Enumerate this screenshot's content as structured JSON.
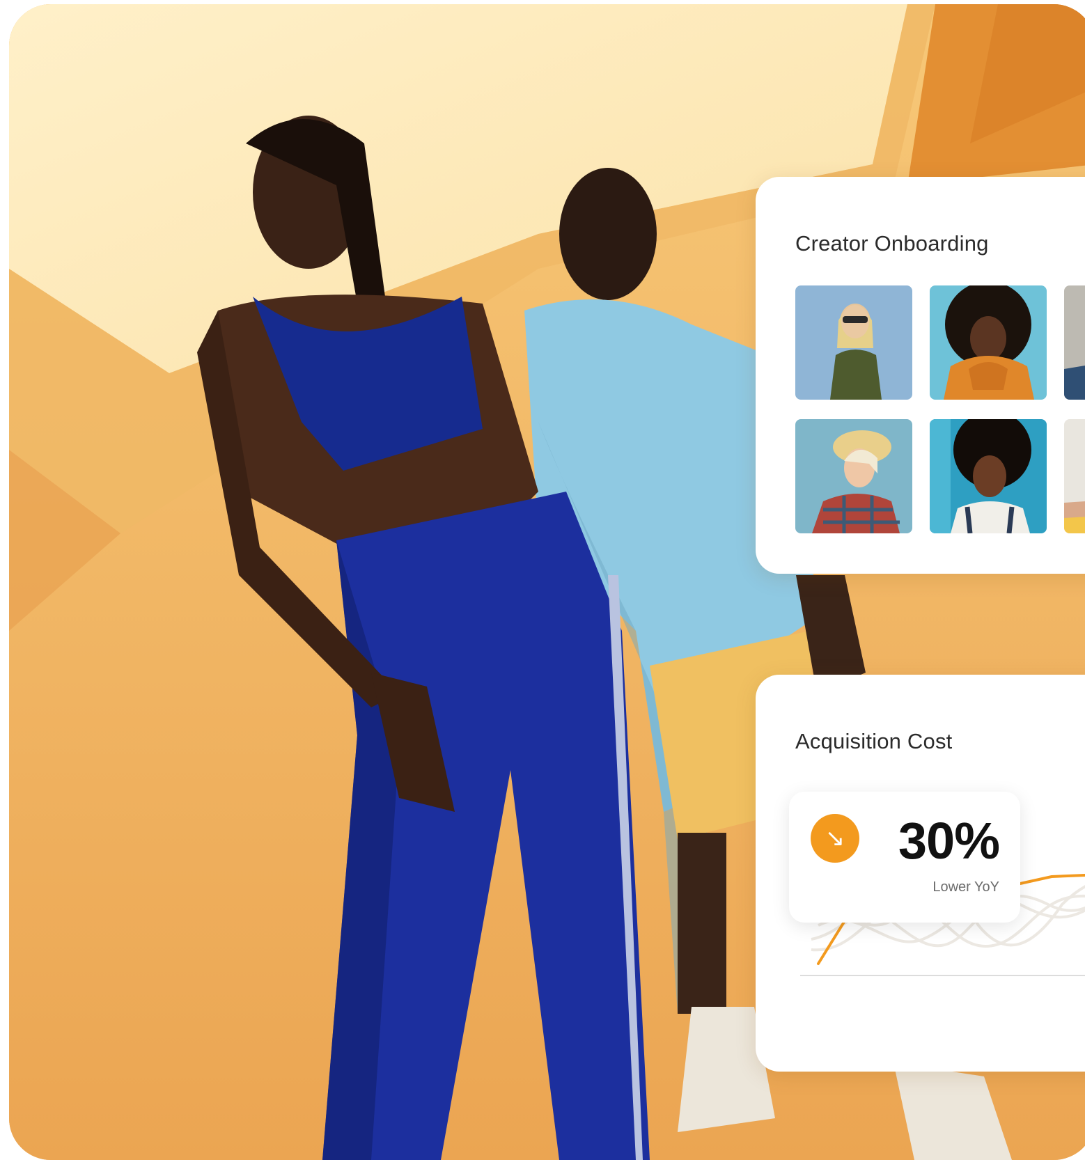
{
  "onboarding": {
    "title": "Creator Onboarding"
  },
  "acquisition": {
    "title": "Acquisition Cost",
    "icon": "arrow-down-right-icon",
    "value": "30%",
    "caption": "Lower YoY",
    "accent_color": "#f39a1e"
  }
}
